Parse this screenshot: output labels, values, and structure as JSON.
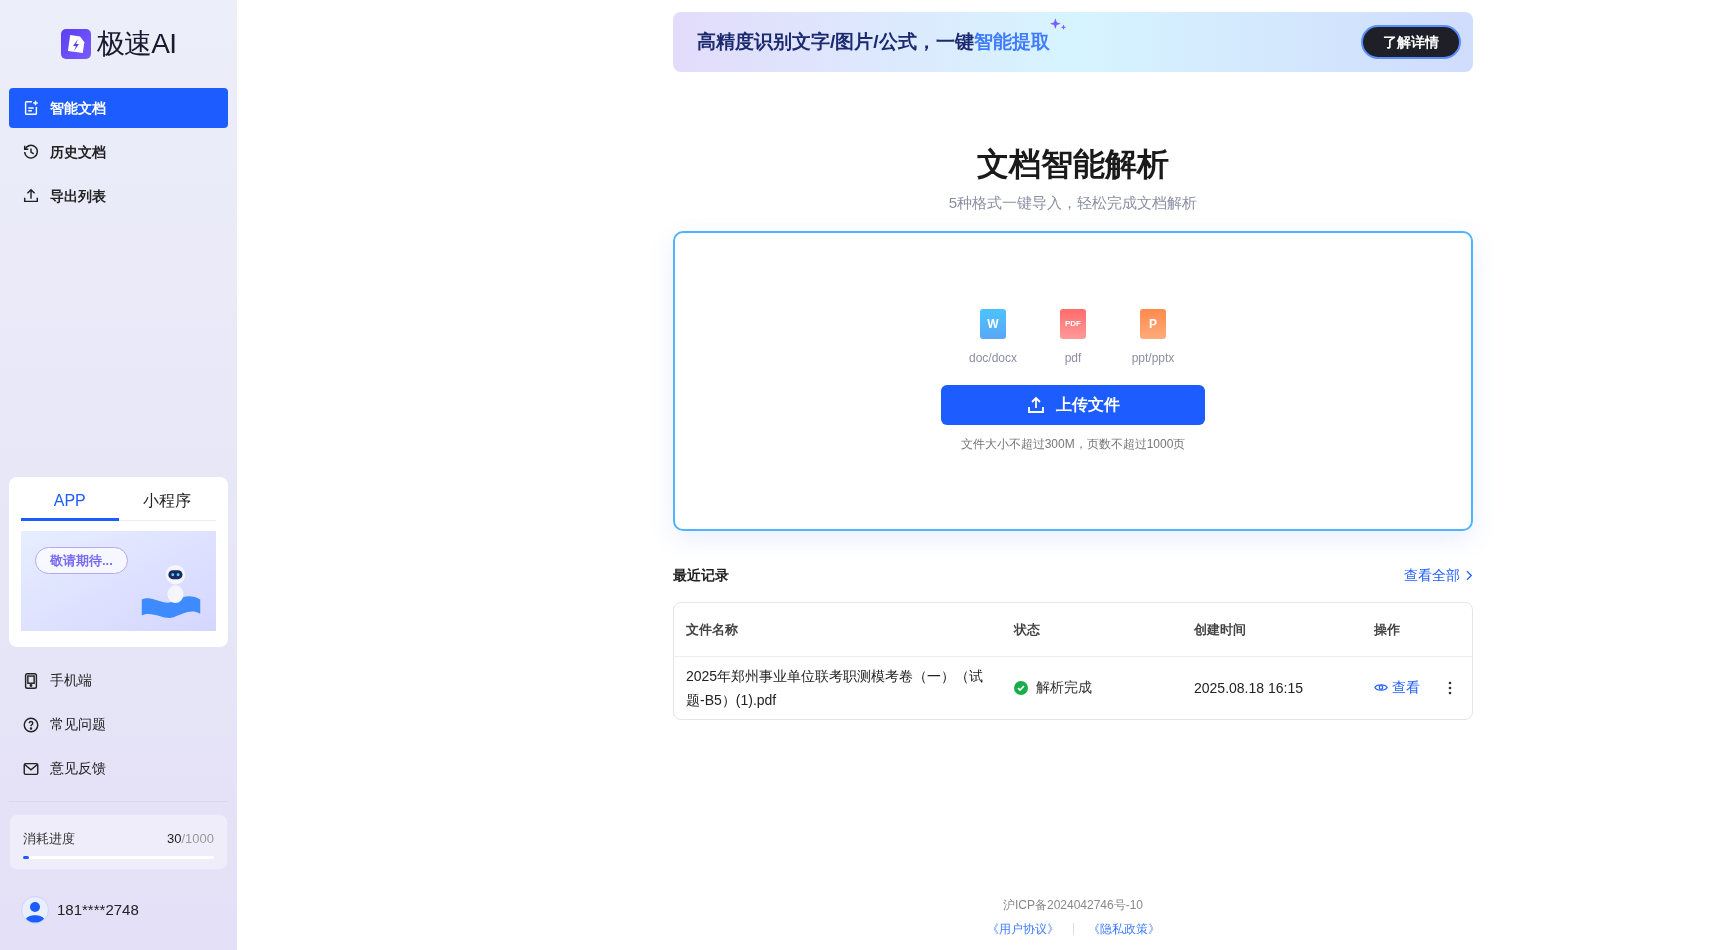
{
  "brand": {
    "name": "极速AI"
  },
  "nav": [
    {
      "label": "智能文档",
      "selected": true
    },
    {
      "label": "历史文档",
      "selected": false
    },
    {
      "label": "导出列表",
      "selected": false
    }
  ],
  "app_card": {
    "tabs": [
      {
        "label": "APP",
        "selected": true
      },
      {
        "label": "小程序",
        "selected": false
      }
    ],
    "promo_text": "敬请期待..."
  },
  "footer_nav": [
    {
      "label": "手机端"
    },
    {
      "label": "常见问题"
    },
    {
      "label": "意见反馈"
    }
  ],
  "usage": {
    "label": "消耗进度",
    "used": "30",
    "total": "/1000",
    "level": 0.03
  },
  "user": {
    "phone": "181****2748"
  },
  "banner": {
    "text": "高精度识别文字/图片/公式，一键",
    "highlight": "智能提取",
    "button": "了解详情"
  },
  "hero": {
    "title": "文档智能解析",
    "subtitle": "5种格式一键导入，轻松完成文档解析"
  },
  "formats": [
    {
      "kind": "word",
      "glyph": "W",
      "label": "doc/docx"
    },
    {
      "kind": "pdf",
      "glyph": "PDF",
      "label": "pdf"
    },
    {
      "kind": "ppt",
      "glyph": "P",
      "label": "ppt/pptx"
    }
  ],
  "upload": {
    "button": "上传文件",
    "hint": "文件大小不超过300M，页数不超过1000页"
  },
  "recent": {
    "title": "最近记录",
    "view_all": "查看全部",
    "columns": [
      "文件名称",
      "状态",
      "创建时间",
      "操作"
    ],
    "rows": [
      {
        "name": "2025年郑州事业单位联考职测模考卷（一）（试题-B5）(1).pdf",
        "status": "解析完成",
        "created": "2025.08.18 16:15",
        "action": "查看"
      }
    ]
  },
  "footer": {
    "icp": "沪ICP备2024042746号-10",
    "links": [
      "《用户协议》",
      "《隐私政策》"
    ]
  }
}
